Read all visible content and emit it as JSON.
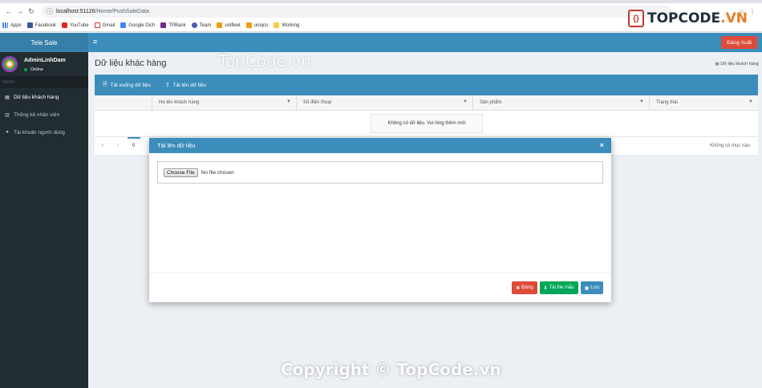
{
  "browser": {
    "url_host": "localhost:51126",
    "url_path": "/Home/PushSaleData",
    "bookmarks": [
      "Apps",
      "Facebook",
      "YouTube",
      "Gmail",
      "Google Dịch",
      "TPBank",
      "Team",
      "unifleet",
      "uniqco",
      "Working"
    ]
  },
  "watermark": {
    "logo_text_a": "TOPCODE",
    "logo_text_b": ".VN",
    "center": "TopCode.vn",
    "bottom": "Copyright © TopCode.vn"
  },
  "header": {
    "app_title": "Tele Sale",
    "logout_label": "Đăng Xuất"
  },
  "sidebar": {
    "user_name": "AdminLinhDam",
    "user_status": "Online",
    "menu_header": "MENU",
    "items": [
      {
        "label": "Dữ liệu khách hàng",
        "icon": "database-icon"
      },
      {
        "label": "Thống kê nhân viên",
        "icon": "bar-chart-icon"
      },
      {
        "label": "Tài khoản người dùng",
        "icon": "user-icon"
      }
    ]
  },
  "main": {
    "title": "Dữ liệu khác hàng",
    "breadcrumb": "Dữ liệu khách hàng",
    "toolbar": {
      "download_label": "Tải xuống dữ liệu",
      "upload_label": "Tải lên dữ liệu"
    },
    "columns": [
      "Họ tên khách hàng",
      "Số điện thoại",
      "Sản phẩm",
      "Trạng thái"
    ],
    "no_data": "Không có dữ liệu. Vui lòng thêm mới",
    "pager": {
      "page": "0",
      "empty_text": "Không có mục nào"
    }
  },
  "modal": {
    "title": "Tải lên dữ liệu",
    "close": "×",
    "choose_file": "Choose File",
    "no_file": "No file chosen",
    "buttons": {
      "close_label": "Đóng",
      "template_label": "Tải file mẫu",
      "save_label": "Lưu"
    }
  },
  "colors": {
    "primary": "#3c8dbc",
    "danger": "#dd4b39",
    "success": "#00a65a",
    "sidebar": "#222d32"
  }
}
